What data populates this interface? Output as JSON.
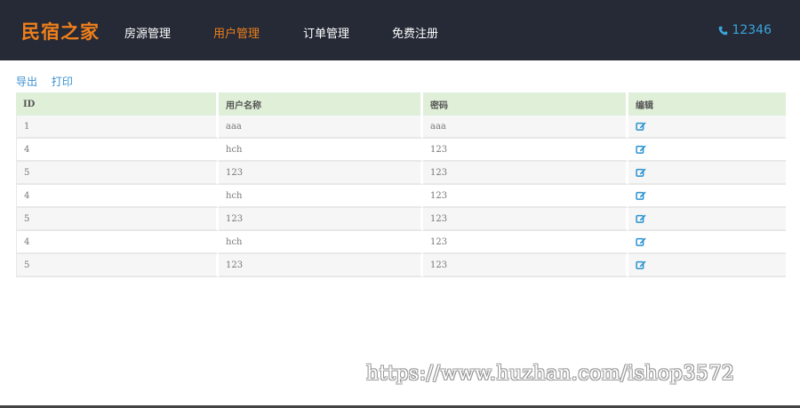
{
  "header": {
    "brand": "民宿之家",
    "nav": [
      {
        "label": "房源管理",
        "active": false
      },
      {
        "label": "用户管理",
        "active": true
      },
      {
        "label": "订单管理",
        "active": false
      },
      {
        "label": "免费注册",
        "active": false
      }
    ],
    "phone": "12346",
    "phone_icon": "phone-icon"
  },
  "actions": {
    "export": "导出",
    "print": "打印"
  },
  "table": {
    "columns": [
      "ID",
      "用户名称",
      "密码",
      "编辑"
    ],
    "rows": [
      {
        "id": "1",
        "name": "aaa",
        "password": "aaa"
      },
      {
        "id": "4",
        "name": "hch",
        "password": "123"
      },
      {
        "id": "5",
        "name": "123",
        "password": "123"
      },
      {
        "id": "4",
        "name": "hch",
        "password": "123"
      },
      {
        "id": "5",
        "name": "123",
        "password": "123"
      },
      {
        "id": "4",
        "name": "hch",
        "password": "123"
      },
      {
        "id": "5",
        "name": "123",
        "password": "123"
      }
    ],
    "edit_icon": "edit-icon"
  },
  "watermark": "https://www.huzhan.com/ishop3572",
  "colors": {
    "accent": "#f07f1b",
    "link": "#3a8fd0",
    "header_bg": "#252a36",
    "table_head_bg": "#dfefd8"
  }
}
